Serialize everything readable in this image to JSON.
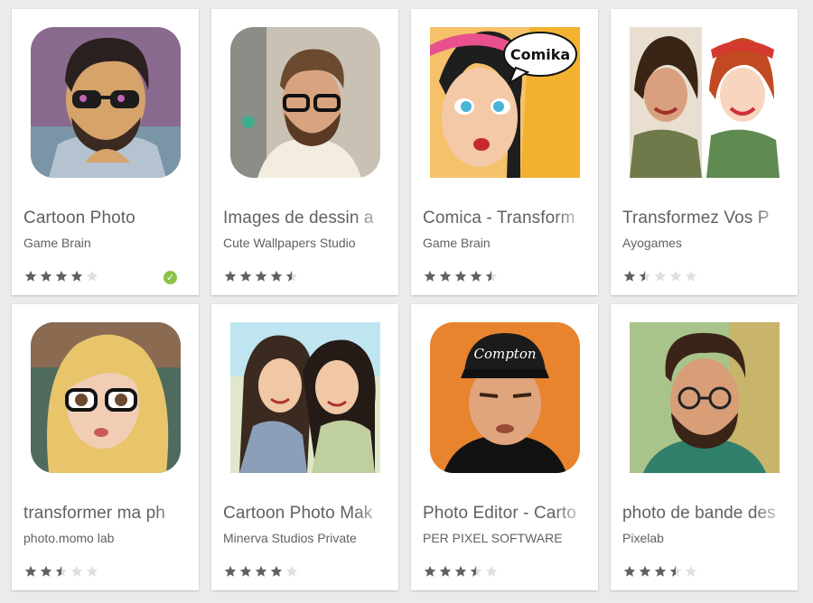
{
  "colors": {
    "background": "#ebebeb",
    "card": "#ffffff",
    "text": "#616161",
    "star_filled": "#616161",
    "star_empty": "#e0e0e0",
    "badge": "#8bc34a"
  },
  "apps": [
    {
      "title": "Cartoon Photo",
      "developer": "Game Brain",
      "rating": 4.0,
      "badge": true,
      "badge_icon": "checkmark-icon"
    },
    {
      "title": "Images de dessin a",
      "developer": "Cute Wallpapers Studio",
      "rating": 4.5
    },
    {
      "title": "Comica - Transform",
      "developer": "Game Brain",
      "rating": 4.5,
      "thumb_text": "Comika"
    },
    {
      "title": "Transformez Vos P",
      "developer": "Ayogames",
      "rating": 1.5
    },
    {
      "title": "transformer ma ph",
      "developer": "photo.momo lab",
      "rating": 2.5
    },
    {
      "title": "Cartoon Photo Mak",
      "developer": "Minerva Studios Private",
      "rating": 4.0
    },
    {
      "title": "Photo Editor - Carto",
      "developer": "PER PIXEL SOFTWARE",
      "rating": 3.5,
      "thumb_text": "Compton"
    },
    {
      "title": "photo de bande des",
      "developer": "Pixelab",
      "rating": 3.5
    }
  ]
}
